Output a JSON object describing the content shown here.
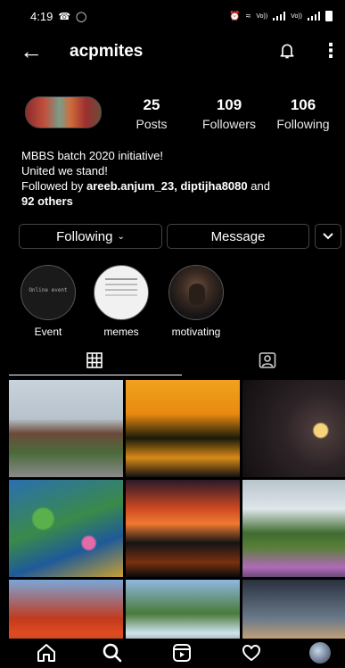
{
  "status_bar": {
    "time": "4:19",
    "carrier_1": "Vo))",
    "carrier_2": "LTE1",
    "carrier_3": "Vo))",
    "carrier_4": "LTE"
  },
  "header": {
    "username": "acpmites"
  },
  "stats": [
    {
      "value": "25",
      "label": "Posts"
    },
    {
      "value": "109",
      "label": "Followers"
    },
    {
      "value": "106",
      "label": "Following"
    }
  ],
  "bio": {
    "line1": "MBBS batch 2020 initiative!",
    "line2": "United we stand!",
    "followed_prefix": "Followed by ",
    "followers_names": "areeb.anjum_23, diptijha8080",
    "and": " and",
    "others": "92 others"
  },
  "buttons": {
    "following": "Following",
    "message": "Message"
  },
  "highlights": [
    {
      "label": "Event",
      "inner_text": "Online event"
    },
    {
      "label": "memes"
    },
    {
      "label": "motivating"
    }
  ],
  "icons": {
    "back": "arrow-left-icon",
    "bell": "bell-icon",
    "more": "more-vertical-icon",
    "grid_tab": "grid-icon",
    "tagged_tab": "tagged-person-icon",
    "home": "home-icon",
    "search": "search-icon",
    "reels": "reels-icon",
    "activity": "heart-icon",
    "profile": "profile-avatar-icon"
  },
  "colors": {
    "background": "#000000",
    "text": "#ffffff",
    "border": "#444444"
  }
}
